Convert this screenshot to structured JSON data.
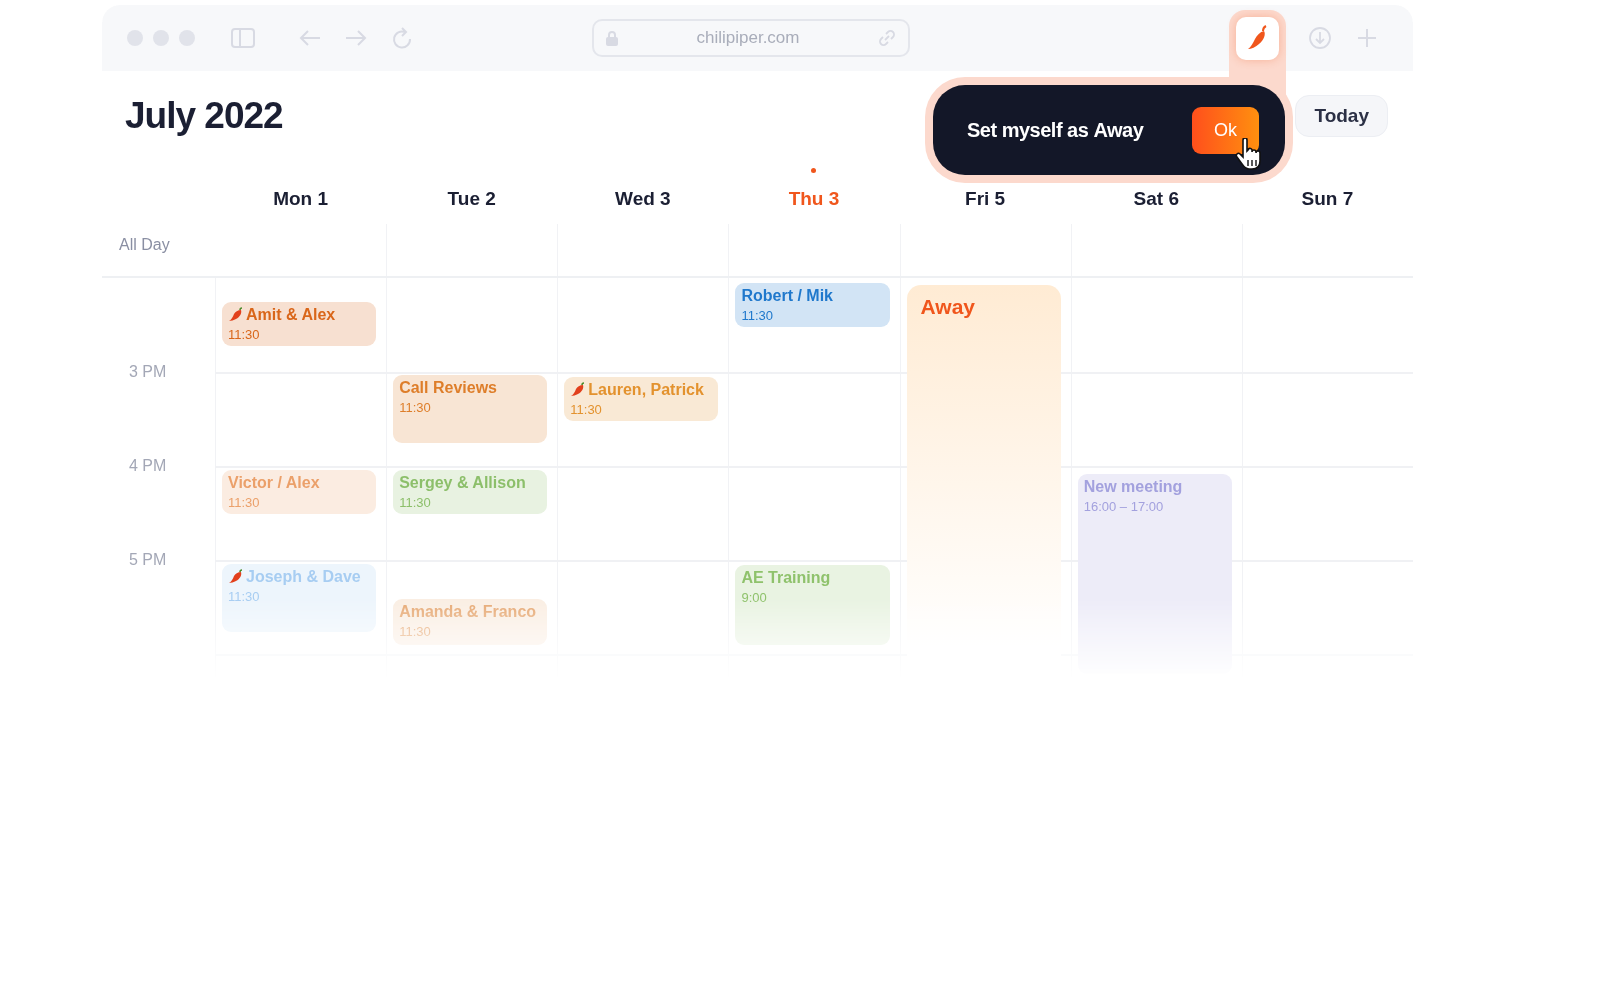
{
  "browser": {
    "address": "chilipiper.com"
  },
  "calendar": {
    "title": "July 2022",
    "today_button": "Today",
    "all_day_label": "All Day",
    "days": [
      {
        "label": "Mon 1",
        "today": false
      },
      {
        "label": "Tue 2",
        "today": false
      },
      {
        "label": "Wed 3",
        "today": false
      },
      {
        "label": "Thu 3",
        "today": true
      },
      {
        "label": "Fri 5",
        "today": false
      },
      {
        "label": "Sat 6",
        "today": false
      },
      {
        "label": "Sun 7",
        "today": false
      }
    ],
    "hours": [
      "3 PM",
      "4 PM",
      "5 PM"
    ],
    "events": [
      {
        "kind": "meeting",
        "title": "Amit & Alex",
        "time": "11:30",
        "chili": true,
        "color": "#d9661a"
      },
      {
        "kind": "meeting",
        "title": "Robert / Mik",
        "time": "11:30",
        "chili": false,
        "color": "#1f78cc"
      },
      {
        "kind": "away",
        "title": "Away",
        "color": "#f0561c"
      },
      {
        "kind": "meeting",
        "title": "Call Reviews",
        "time": "11:30",
        "chili": false,
        "color": "#de7e2a"
      },
      {
        "kind": "meeting",
        "title": "Lauren, Patrick",
        "time": "11:30",
        "chili": true,
        "color": "#e3922e"
      },
      {
        "kind": "meeting",
        "title": "Victor / Alex",
        "time": "11:30",
        "chili": false,
        "color": "#eba06a"
      },
      {
        "kind": "meeting",
        "title": "Sergey & Allison",
        "time": "11:30",
        "chili": false,
        "color": "#8cbf6a"
      },
      {
        "kind": "meeting",
        "title": "New meeting",
        "time": "16:00 – 17:00",
        "chili": false,
        "color": "#a3a1de"
      },
      {
        "kind": "meeting",
        "title": "Joseph & Dave",
        "time": "11:30",
        "chili": true,
        "color": "#a7cdf2"
      },
      {
        "kind": "meeting",
        "title": "Amanda & Franco",
        "time": "11:30",
        "chili": false,
        "color": "#e6a873"
      },
      {
        "kind": "meeting",
        "title": "AE Training",
        "time": "9:00",
        "chili": false,
        "color": "#8fc26c"
      }
    ]
  },
  "popup": {
    "text": "Set myself as **Away**",
    "button": "Ok"
  }
}
